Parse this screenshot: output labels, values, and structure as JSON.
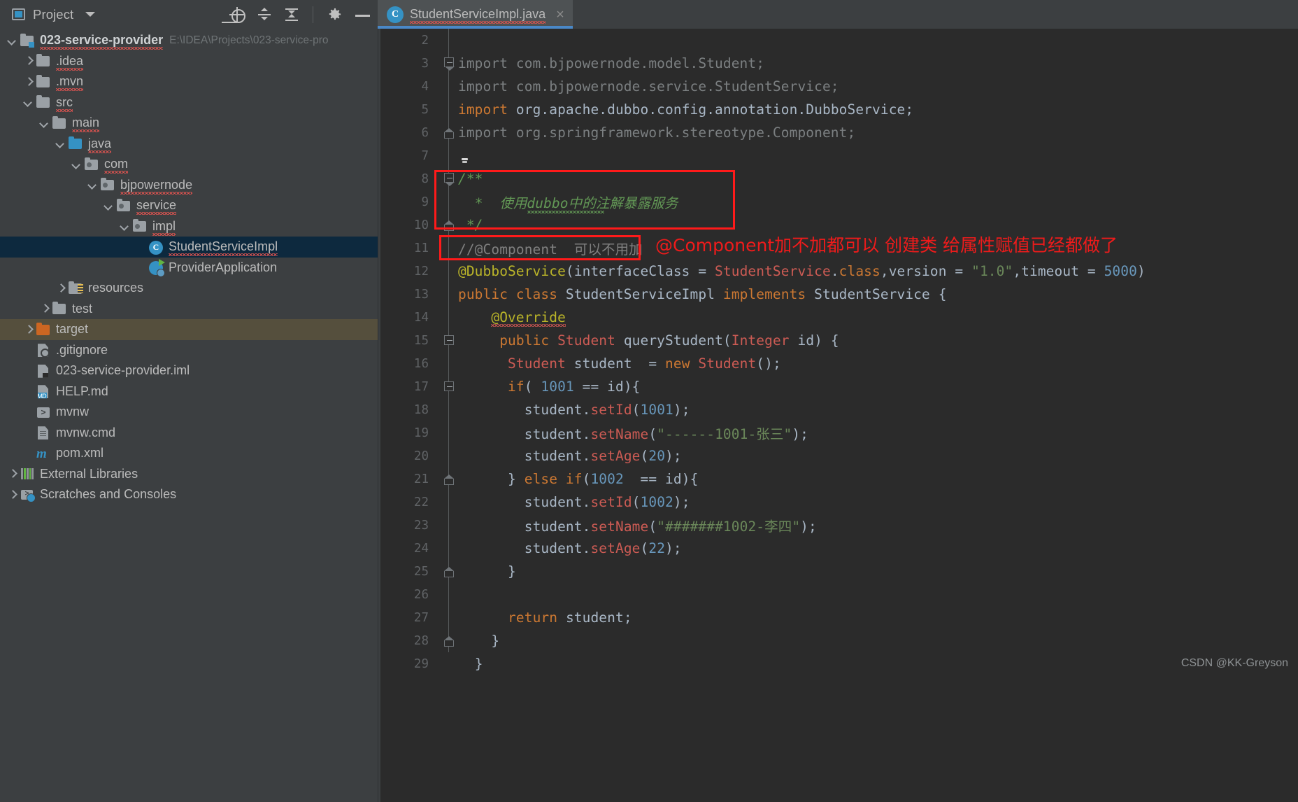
{
  "project_panel": {
    "title": "Project",
    "icons": [
      "project-view-icon",
      "locate-icon",
      "expand-all-icon",
      "collapse-all-icon",
      "settings-gear-icon",
      "minimize-icon"
    ],
    "root": {
      "name": "023-service-provider",
      "path": "E:\\IDEA\\Projects\\023-service-pro"
    },
    "items": [
      {
        "label": ".idea",
        "indent": 1,
        "arrow": "right",
        "icon": "folder-icon"
      },
      {
        "label": ".mvn",
        "indent": 1,
        "arrow": "right",
        "icon": "folder-icon"
      },
      {
        "label": "src",
        "indent": 1,
        "arrow": "down",
        "icon": "folder-icon"
      },
      {
        "label": "main",
        "indent": 2,
        "arrow": "down",
        "icon": "folder-icon"
      },
      {
        "label": "java",
        "indent": 3,
        "arrow": "down",
        "icon": "source-folder-icon"
      },
      {
        "label": "com",
        "indent": 4,
        "arrow": "down",
        "icon": "package-icon"
      },
      {
        "label": "bjpowernode",
        "indent": 5,
        "arrow": "down",
        "icon": "package-icon"
      },
      {
        "label": "service",
        "indent": 6,
        "arrow": "down",
        "icon": "package-icon"
      },
      {
        "label": "impl",
        "indent": 7,
        "arrow": "down",
        "icon": "package-icon"
      },
      {
        "label": "StudentServiceImpl",
        "indent": 8,
        "arrow": "none",
        "icon": "java-class-icon",
        "selected": true
      },
      {
        "label": "ProviderApplication",
        "indent": 8,
        "arrow": "none",
        "icon": "spring-boot-run-icon"
      },
      {
        "label": "resources",
        "indent": 3,
        "arrow": "right",
        "icon": "resources-folder-icon"
      },
      {
        "label": "test",
        "indent": 2,
        "arrow": "right",
        "icon": "folder-icon"
      },
      {
        "label": "target",
        "indent": 1,
        "arrow": "right",
        "icon": "excluded-folder-icon",
        "dim_selected": true
      },
      {
        "label": ".gitignore",
        "indent": 1,
        "arrow": "none",
        "icon": "gitignore-file-icon"
      },
      {
        "label": "023-service-provider.iml",
        "indent": 1,
        "arrow": "none",
        "icon": "iml-file-icon"
      },
      {
        "label": "HELP.md",
        "indent": 1,
        "arrow": "none",
        "icon": "markdown-file-icon"
      },
      {
        "label": "mvnw",
        "indent": 1,
        "arrow": "none",
        "icon": "shell-script-icon"
      },
      {
        "label": "mvnw.cmd",
        "indent": 1,
        "arrow": "none",
        "icon": "cmd-file-icon"
      },
      {
        "label": "pom.xml",
        "indent": 1,
        "arrow": "none",
        "icon": "maven-pom-icon"
      },
      {
        "label": "External Libraries",
        "indent": 0,
        "arrow": "right",
        "icon": "libraries-icon"
      },
      {
        "label": "Scratches and Consoles",
        "indent": 0,
        "arrow": "right",
        "icon": "scratches-icon"
      }
    ]
  },
  "editor": {
    "tab": {
      "label": "StudentServiceImpl.java",
      "icon": "java-class-icon",
      "close": "×"
    },
    "line_numbers": [
      "2",
      "3",
      "4",
      "5",
      "6",
      "7",
      "8",
      "9",
      "10",
      "11",
      "12",
      "13",
      "14",
      "15",
      "16",
      "17",
      "18",
      "19",
      "20",
      "21",
      "22",
      "23",
      "24",
      "25",
      "26",
      "27",
      "28",
      "29"
    ],
    "lines": {
      "l3": "import com.bjpowernode.model.Student;",
      "l4": "import com.bjpowernode.service.StudentService;",
      "l5_kw": "import ",
      "l5_rest": "org.apache.dubbo.config.annotation.",
      "l5_cls": "DubboService",
      "l6": "import org.springframework.stereotype.Component;",
      "l8": "/**",
      "l9_star": "*",
      "l9_text": "使用dubbo中的注解暴露服务",
      "l10": "*/",
      "l11_a": "//@Component",
      "l11_b": "可以不用加",
      "l12_ann": "@DubboService",
      "l12_p1": "(interfaceClass = ",
      "l12_cls": "StudentService",
      "l12_p2": ".",
      "l12_kw1": "class",
      "l12_p3": ",version = ",
      "l12_s1": "\"1.0\"",
      "l12_p4": ",timeout = ",
      "l12_n1": "5000",
      "l12_p5": ")",
      "l13_kw": "public class ",
      "l13_name": "StudentServiceImpl",
      "l13_kw2": " implements ",
      "l13_iface": "StudentService",
      "l13_brace": " {",
      "l14": "@Override",
      "l15_kw": "public ",
      "l15_type": "Student",
      "l15_name": " queryStudent",
      "l15_p1": "(",
      "l15_ptype": "Integer",
      "l15_pname": " id",
      "l15_p2": ") {",
      "l16_type": "Student",
      "l16_var": " student  = ",
      "l16_kw": "new ",
      "l16_ctor": "Student",
      "l16_end": "();",
      "l17_kw": "if",
      "l17_p1": "( ",
      "l17_num": "1001",
      "l17_p2": " == id){",
      "l18_obj": "student.",
      "l18_m": "setId",
      "l18_p1": "(",
      "l18_n": "1001",
      "l18_p2": ");",
      "l19_obj": "student.",
      "l19_m": "setName",
      "l19_p1": "(",
      "l19_s": "\"------1001-张三\"",
      "l19_p2": ");",
      "l20_obj": "student.",
      "l20_m": "setAge",
      "l20_p1": "(",
      "l20_n": "20",
      "l20_p2": ");",
      "l21_p0": "} ",
      "l21_kw": "else if",
      "l21_p1": "(",
      "l21_n": "1002",
      "l21_p2": "  == id){",
      "l22_obj": "student.",
      "l22_m": "setId",
      "l22_p1": "(",
      "l22_n": "1002",
      "l22_p2": ");",
      "l23_obj": "student.",
      "l23_m": "setName",
      "l23_p1": "(",
      "l23_s": "\"#######1002-李四\"",
      "l23_p2": ");",
      "l24_obj": "student.",
      "l24_m": "setAge",
      "l24_p1": "(",
      "l24_n": "22",
      "l24_p2": ");",
      "l25": "}",
      "l27_kw": "return ",
      "l27_var": "student;",
      "l28": "}",
      "l29": "}"
    },
    "annotations": [
      {
        "name": "javadoc-red-box",
        "text": ""
      },
      {
        "name": "component-comment-red-box",
        "text": ""
      },
      {
        "name": "red-note",
        "text": "@Component加不加都可以 创建类 给属性赋值已经都做了"
      }
    ],
    "gutter_bulb": "intention-bulb-icon"
  },
  "watermark": "CSDN @KK-Greyson",
  "colors": {
    "bg_panel": "#3c3f41",
    "bg_editor": "#2b2b2b",
    "selection": "#0d293e",
    "accent_blue": "#3592c4",
    "tab_underline": "#4a88c7",
    "annotation_red": "#ee1b1b",
    "string_green": "#6a8759",
    "doc_green": "#629755",
    "keyword_orange": "#cc7832",
    "number_blue": "#6897bb",
    "annotation_yellow": "#bbb529",
    "class_red": "#cc5b54"
  }
}
